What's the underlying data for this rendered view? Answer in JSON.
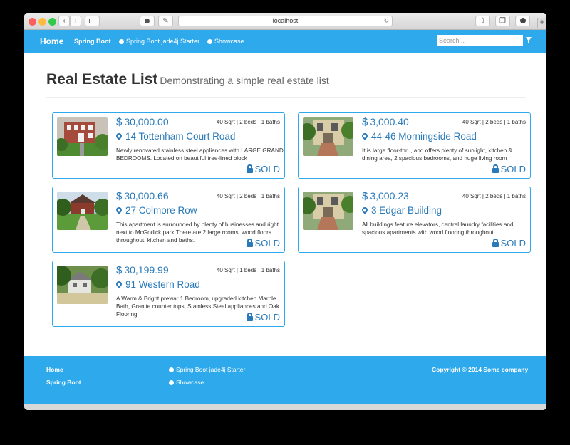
{
  "browser": {
    "url": "localhost"
  },
  "navbar": {
    "brand": "Home",
    "links": [
      {
        "label": "Spring Boot"
      },
      {
        "label": "Spring Boot jade4j Starter"
      },
      {
        "label": "Showcase"
      }
    ],
    "search_placeholder": "Search..."
  },
  "page": {
    "title": "Real Estate List",
    "subtitle": "Demonstrating a simple real estate list"
  },
  "listings": [
    {
      "price": "30,000.00",
      "stats": "| 40 Sqrt | 2 beds | 1 baths",
      "address": "14 Tottenham Court Road",
      "description": "Newly renovated stainless steel appliances with LARGE GRAND BEDROOMS. Located on beautiful tree-lined block",
      "status": "SOLD"
    },
    {
      "price": "3,000.40",
      "stats": "| 40 Sqrt | 2 beds | 1 baths",
      "address": "44-46 Morningside Road",
      "description": "It is large floor-thru, and offers plenty of sunlight, kitchen & dining area, 2 spacious bedrooms, and huge living room",
      "status": "SOLD"
    },
    {
      "price": "30,000.66",
      "stats": "| 40 Sqrt | 2 beds | 1 baths",
      "address": "27 Colmore Row",
      "description": "This apartment is surrounded by plenty of businesses and right next to McGorlick park.There are 2 large rooms, wood floors throughout, kitchen and baths.",
      "status": "SOLD"
    },
    {
      "price": "3,000.23",
      "stats": "| 40 Sqrt | 2 beds | 1 baths",
      "address": "3 Edgar Building",
      "description": "All buildings feature elevators, central laundry facilities and spacious apartments with wood flooring throughout",
      "status": "SOLD"
    },
    {
      "price": "30,199.99",
      "stats": "| 40 Sqrt | 1 beds | 1 baths",
      "address": "91 Western Road",
      "description": "A Warm & Bright prewar 1 Bedroom, upgraded kitchen Marble Bath, Granite counter tops, Stainless Steel appliances and Oak Flooring",
      "status": "SOLD"
    }
  ],
  "footer": {
    "home": "Home",
    "spring_boot": "Spring Boot",
    "starter": "Spring Boot jade4j Starter",
    "showcase": "Showcase",
    "copyright": "Copyright © 2014 Some company"
  },
  "colors": {
    "brand_blue": "#2ea9ec",
    "link_blue": "#2a7ab9"
  }
}
